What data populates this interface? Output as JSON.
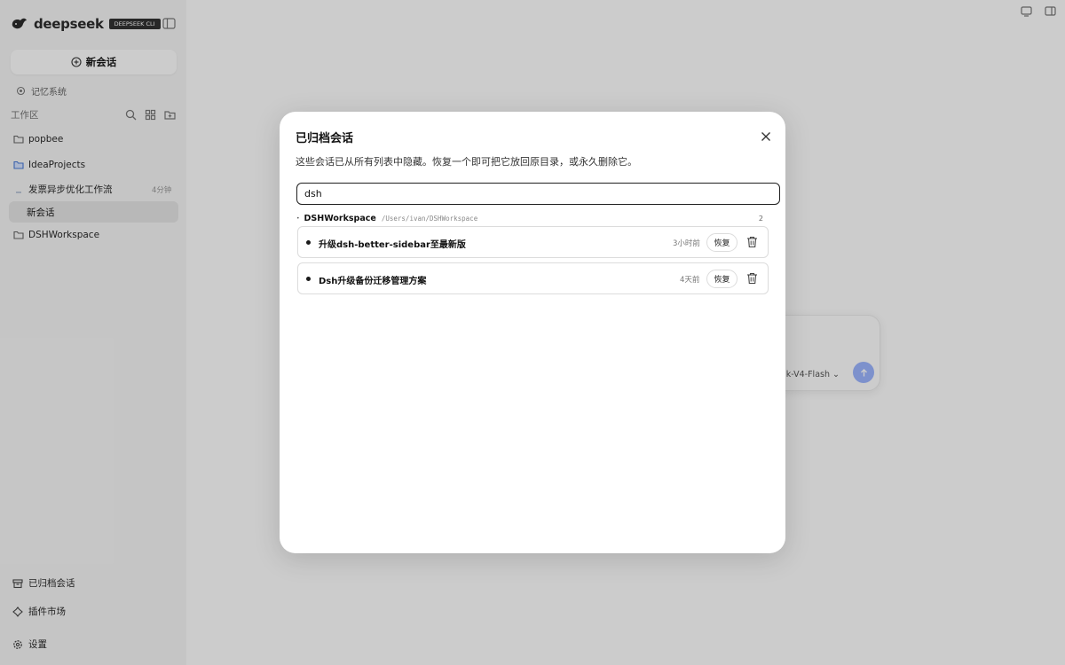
{
  "app": {
    "logo_text": "deepseek",
    "logo_badge": "DEEPSEEK CLI"
  },
  "sidebar": {
    "new_chat_label": "新会话",
    "memory_label": "记忆系统",
    "workspace_label": "工作区",
    "tree": [
      {
        "label": "popbee",
        "icon": "folder-icon"
      },
      {
        "label": "IdeaProjects",
        "icon": "folder-open-icon"
      },
      {
        "label": "发票异步优化工作流",
        "time": "4分钟",
        "icon": "chat-indicator"
      },
      {
        "label": "新会话",
        "active": true
      },
      {
        "label": "DSHWorkspace",
        "icon": "folder-icon"
      }
    ],
    "bottom": [
      {
        "label": "已归档会话",
        "icon": "archive-icon"
      },
      {
        "label": "插件市场",
        "icon": "plugin-icon"
      },
      {
        "label": "设置",
        "icon": "gear-icon"
      }
    ]
  },
  "composer": {
    "model_label": "k-V4-Flash"
  },
  "modal": {
    "title": "已归档会话",
    "description": "这些会话已从所有列表中隐藏。恢复一个即可把它放回原目录，或永久删除它。",
    "search_value": "dsh",
    "group": {
      "name": "DSHWorkspace",
      "path": "/Users/ivan/DSHWorkspace",
      "count": "2"
    },
    "conversations": [
      {
        "title": "升级dsh-better-sidebar至最新版",
        "time": "3小时前",
        "restore_label": "恢复"
      },
      {
        "title": "Dsh升级备份迁移管理方案",
        "time": "4天前",
        "restore_label": "恢复"
      }
    ]
  },
  "colors": {
    "overlay": "#00000033",
    "send_button": "#9db6ff",
    "logo": "#2c2c2c"
  }
}
